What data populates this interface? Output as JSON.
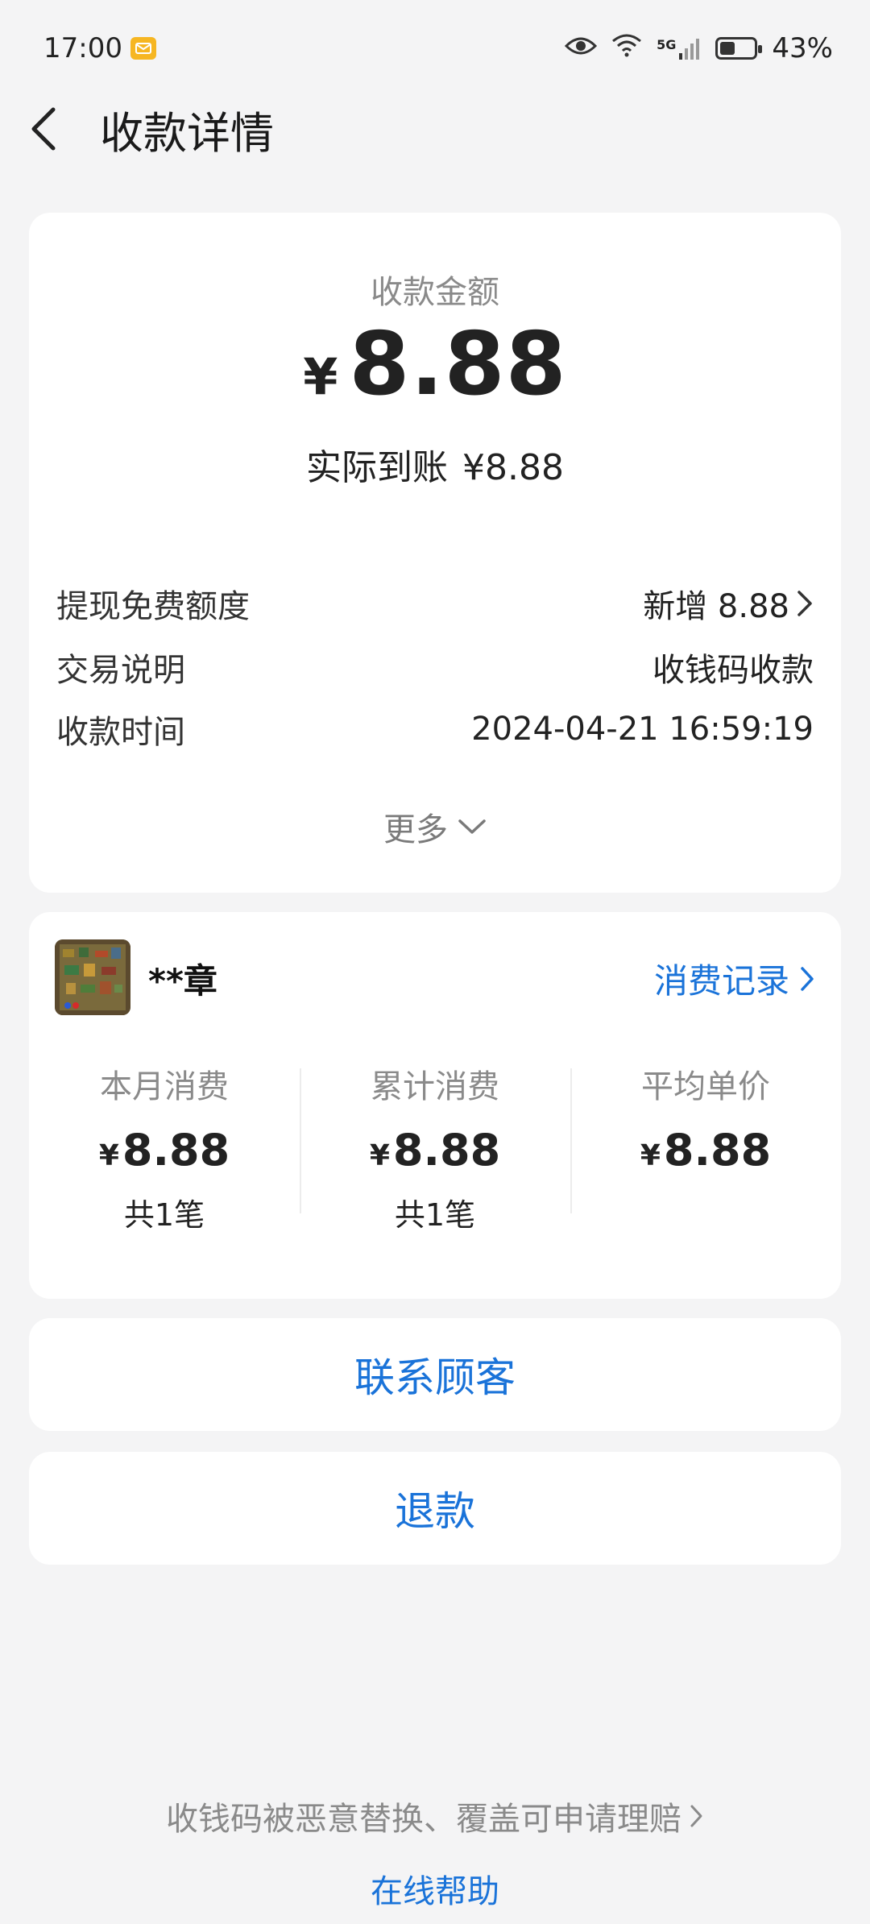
{
  "status_bar": {
    "time": "17:00",
    "network": "5G",
    "battery": "43%",
    "battery_level": 0.43
  },
  "header": {
    "title": "收款详情",
    "back_icon": "back-arrow-icon"
  },
  "summary": {
    "amount_label": "收款金额",
    "currency": "¥",
    "amount": "8.88",
    "received_label": "实际到账",
    "received_amount": "¥8.88"
  },
  "details": [
    {
      "label": "提现免费额度",
      "value": "新增 8.88",
      "has_arrow": true
    },
    {
      "label": "交易说明",
      "value": "收钱码收款",
      "has_arrow": false
    },
    {
      "label": "收款时间",
      "value": "2024-04-21 16:59:19",
      "has_arrow": false
    }
  ],
  "more_label": "更多",
  "customer": {
    "name": "**章",
    "records_link": "消费记录",
    "stats": [
      {
        "label": "本月消费",
        "currency": "¥",
        "value": "8.88",
        "count": "共1笔"
      },
      {
        "label": "累计消费",
        "currency": "¥",
        "value": "8.88",
        "count": "共1笔"
      },
      {
        "label": "平均单价",
        "currency": "¥",
        "value": "8.88",
        "count": ""
      }
    ]
  },
  "actions": {
    "contact": "联系顾客",
    "refund": "退款"
  },
  "footer": {
    "claim_text": "收钱码被恶意替换、覆盖可申请理赔",
    "help_link": "在线帮助"
  },
  "colors": {
    "accent": "#1a73d9",
    "background": "#f4f4f5",
    "card": "#ffffff",
    "muted_text": "#8a8a8a"
  }
}
